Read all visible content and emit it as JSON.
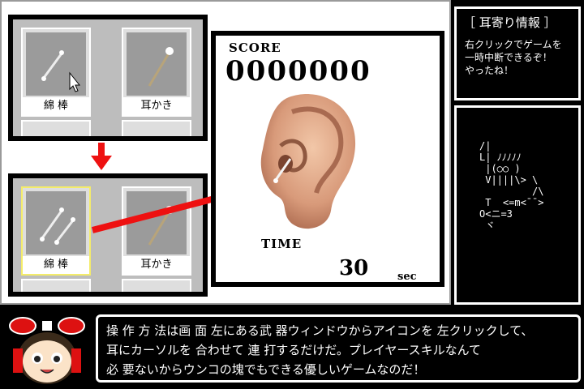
{
  "weapon_window_top": {
    "items": [
      {
        "label": "綿 棒",
        "icon": "cotton-swab-icon"
      },
      {
        "label": "耳かき",
        "icon": "ear-pick-icon"
      }
    ]
  },
  "weapon_window_bottom": {
    "items": [
      {
        "label": "綿 棒",
        "icon": "cotton-swab-icon",
        "selected": true
      },
      {
        "label": "耳かき",
        "icon": "ear-pick-icon"
      }
    ]
  },
  "game": {
    "score_label": "SCORE",
    "score_value": "0000000",
    "time_label": "TIME",
    "time_value": "30",
    "time_unit": "sec"
  },
  "info_panel": {
    "title": "［ 耳寄り情報 ］",
    "body": "右クリックでゲームを\n一時中断できるぞ！\nやったね！"
  },
  "ascii_art": "/|\nL| ﾉﾉﾉﾉﾉ\n |(○○ )\n V||||\\> \\\n         /\\\n T  <=m<¯¯>\nO<ニ=3\n ヾ",
  "dialog": {
    "lines": [
      "操 作 方 法は画 面 左にある武 器ウィンドウからアイコンを 左クリックして、",
      "耳にカーソルを 合わせて 連 打するだけだ。プレイヤースキルなんて",
      "必 要ないからウンコの塊でもできる優しいゲームなのだ！"
    ]
  },
  "colors": {
    "arrow": "#ee1111",
    "selection": "#f4ec6a",
    "tray": "#bdbdbd"
  }
}
